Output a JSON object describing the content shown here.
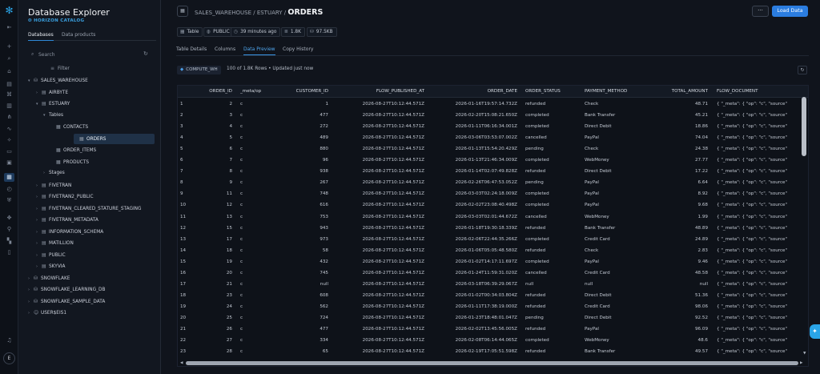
{
  "rail": {
    "icons": [
      "back-icon",
      "add-icon",
      "search-icon",
      "home-icon",
      "worksheet-icon",
      "code-icon",
      "dashboard-icon",
      "graph-icon",
      "activity-icon",
      "ai-icon",
      "marketplace-icon",
      "projects-icon",
      "data-icon",
      "monitor-icon",
      "governance-icon",
      "admin-icon",
      "integrations-icon",
      "compute-icon",
      "docs-icon",
      "notifications-icon"
    ],
    "avatar_initial": "E"
  },
  "explorer": {
    "title": "Database Explorer",
    "subtitle": "HORIZON CATALOG",
    "tabs": [
      {
        "label": "Databases",
        "active": true
      },
      {
        "label": "Data products",
        "active": false
      }
    ],
    "search_placeholder": "Search",
    "filter_label": "Filter",
    "tree": [
      {
        "label": "SALES_WAREHOUSE",
        "depth": 0,
        "caret": "▾",
        "icon": "database-icon"
      },
      {
        "label": "AIRBYTE",
        "depth": 1,
        "caret": "›",
        "icon": "schema-icon"
      },
      {
        "label": "ESTUARY",
        "depth": 1,
        "caret": "▾",
        "icon": "schema-icon"
      },
      {
        "label": "Tables",
        "depth": 2,
        "caret": "▾",
        "icon": ""
      },
      {
        "label": "CONTACTS",
        "depth": 3,
        "caret": "",
        "icon": "table-icon"
      },
      {
        "label": "ORDERS",
        "depth": 3,
        "caret": "",
        "icon": "table-icon",
        "selected": true
      },
      {
        "label": "ORDER_ITEMS",
        "depth": 3,
        "caret": "",
        "icon": "table-icon"
      },
      {
        "label": "PRODUCTS",
        "depth": 3,
        "caret": "",
        "icon": "table-icon"
      },
      {
        "label": "Stages",
        "depth": 2,
        "caret": "›",
        "icon": ""
      },
      {
        "label": "FIVETRAN",
        "depth": 1,
        "caret": "›",
        "icon": "schema-icon"
      },
      {
        "label": "FIVETRAN2_PUBLIC",
        "depth": 1,
        "caret": "›",
        "icon": "schema-icon"
      },
      {
        "label": "FIVETRAN_CLEARED_STATURE_STAGING",
        "depth": 1,
        "caret": "›",
        "icon": "schema-icon"
      },
      {
        "label": "FIVETRAN_METADATA",
        "depth": 1,
        "caret": "›",
        "icon": "schema-icon"
      },
      {
        "label": "INFORMATION_SCHEMA",
        "depth": 1,
        "caret": "›",
        "icon": "schema-icon"
      },
      {
        "label": "MATILLION",
        "depth": 1,
        "caret": "›",
        "icon": "schema-icon"
      },
      {
        "label": "PUBLIC",
        "depth": 1,
        "caret": "›",
        "icon": "schema-icon"
      },
      {
        "label": "SKYVIA",
        "depth": 1,
        "caret": "›",
        "icon": "schema-icon"
      },
      {
        "label": "SNOWFLAKE",
        "depth": 0,
        "caret": "›",
        "icon": "database-icon"
      },
      {
        "label": "SNOWFLAKE_LEARNING_DB",
        "depth": 0,
        "caret": "›",
        "icon": "database-icon"
      },
      {
        "label": "SNOWFLAKE_SAMPLE_DATA",
        "depth": 0,
        "caret": "›",
        "icon": "database-icon"
      },
      {
        "label": "USER$EIS1",
        "depth": 0,
        "caret": "›",
        "icon": "user-icon"
      }
    ]
  },
  "header": {
    "path": "SALES_WAREHOUSE / ESTUARY /",
    "current": "ORDERS",
    "more_label": "···",
    "load_label": "Load Data"
  },
  "chips": [
    {
      "icon": "table-icon",
      "label": "Table"
    },
    {
      "icon": "globe-icon",
      "label": "PUBLIC"
    },
    {
      "icon": "clock-icon",
      "label": "39 minutes ago"
    },
    {
      "icon": "rows-icon",
      "label": "1.8K"
    },
    {
      "icon": "storage-icon",
      "label": "97.5KB"
    }
  ],
  "tabs": [
    {
      "label": "Table Details",
      "active": false
    },
    {
      "label": "Columns",
      "active": false
    },
    {
      "label": "Data Preview",
      "active": true
    },
    {
      "label": "Copy History",
      "active": false
    }
  ],
  "toolbar": {
    "warehouse": "COMPUTE_WH",
    "rows_info": "100 of 1.8K Rows • Updated just now"
  },
  "grid": {
    "columns": [
      "",
      "ORDER_ID",
      "_meta/op",
      "CUSTOMER_ID",
      "FLOW_PUBLISHED_AT",
      "ORDER_DATE",
      "ORDER_STATUS",
      "PAYMENT_METHOD",
      "TOTAL_AMOUNT",
      "FLOW_DOCUMENT"
    ],
    "rows": [
      [
        "1",
        "2",
        "c",
        "1",
        "2026-08-27T10:12:44.571Z",
        "2026-01-16T19:57:14.732Z",
        "refunded",
        "Check",
        "48.71",
        "{ \"_meta\": { \"op\": \"c\", \"source\""
      ],
      [
        "2",
        "3",
        "c",
        "477",
        "2026-08-27T10:12:44.571Z",
        "2026-02-20T15:08:21.650Z",
        "completed",
        "Bank Transfer",
        "45.21",
        "{ \"_meta\": { \"op\": \"c\", \"source\""
      ],
      [
        "3",
        "4",
        "c",
        "272",
        "2026-08-27T10:12:44.571Z",
        "2026-01-11T06:16:34.001Z",
        "completed",
        "Direct Debit",
        "18.86",
        "{ \"_meta\": { \"op\": \"c\", \"source\""
      ],
      [
        "4",
        "5",
        "c",
        "489",
        "2026-08-27T10:12:44.571Z",
        "2026-03-06T03:53:07.002Z",
        "cancelled",
        "PayPal",
        "74.04",
        "{ \"_meta\": { \"op\": \"c\", \"source\""
      ],
      [
        "5",
        "6",
        "c",
        "880",
        "2026-08-27T10:12:44.571Z",
        "2026-01-13T15:54:20.429Z",
        "pending",
        "Check",
        "24.38",
        "{ \"_meta\": { \"op\": \"c\", \"source\""
      ],
      [
        "6",
        "7",
        "c",
        "96",
        "2026-08-27T10:12:44.571Z",
        "2026-01-13T21:46:34.009Z",
        "completed",
        "WebMoney",
        "27.77",
        "{ \"_meta\": { \"op\": \"c\", \"source\""
      ],
      [
        "7",
        "8",
        "c",
        "938",
        "2026-08-27T10:12:44.571Z",
        "2026-01-14T02:07:49.828Z",
        "refunded",
        "Direct Debit",
        "17.22",
        "{ \"_meta\": { \"op\": \"c\", \"source\""
      ],
      [
        "8",
        "9",
        "c",
        "267",
        "2026-08-27T10:12:44.571Z",
        "2026-02-26T06:47:53.052Z",
        "pending",
        "PayPal",
        "6.64",
        "{ \"_meta\": { \"op\": \"c\", \"source\""
      ],
      [
        "9",
        "11",
        "c",
        "748",
        "2026-08-27T10:12:44.571Z",
        "2026-03-03T02:24:18.009Z",
        "completed",
        "PayPal",
        "8.92",
        "{ \"_meta\": { \"op\": \"c\", \"source\""
      ],
      [
        "10",
        "12",
        "c",
        "616",
        "2026-08-27T10:12:44.571Z",
        "2026-02-02T23:08:40.498Z",
        "completed",
        "PayPal",
        "9.68",
        "{ \"_meta\": { \"op\": \"c\", \"source\""
      ],
      [
        "11",
        "13",
        "c",
        "753",
        "2026-08-27T10:12:44.571Z",
        "2026-03-03T02:01:44.672Z",
        "cancelled",
        "WebMoney",
        "1.99",
        "{ \"_meta\": { \"op\": \"c\", \"source\""
      ],
      [
        "12",
        "15",
        "c",
        "943",
        "2026-08-27T10:12:44.571Z",
        "2026-01-18T19:30:18.339Z",
        "refunded",
        "Bank Transfer",
        "48.89",
        "{ \"_meta\": { \"op\": \"c\", \"source\""
      ],
      [
        "13",
        "17",
        "c",
        "973",
        "2026-08-27T10:12:44.571Z",
        "2026-02-06T22:44:35.266Z",
        "completed",
        "Credit Card",
        "24.89",
        "{ \"_meta\": { \"op\": \"c\", \"source\""
      ],
      [
        "14",
        "18",
        "c",
        "58",
        "2026-08-27T10:12:44.571Z",
        "2026-01-06T05:05:48.580Z",
        "refunded",
        "Check",
        "2.83",
        "{ \"_meta\": { \"op\": \"c\", \"source\""
      ],
      [
        "15",
        "19",
        "c",
        "432",
        "2026-08-27T10:12:44.571Z",
        "2026-01-02T14:17:11.697Z",
        "completed",
        "PayPal",
        "9.46",
        "{ \"_meta\": { \"op\": \"c\", \"source\""
      ],
      [
        "16",
        "20",
        "c",
        "745",
        "2026-08-27T10:12:44.571Z",
        "2026-01-24T11:59:31.020Z",
        "cancelled",
        "Credit Card",
        "48.58",
        "{ \"_meta\": { \"op\": \"c\", \"source\""
      ],
      [
        "17",
        "21",
        "c",
        "null",
        "2026-08-27T10:12:44.571Z",
        "2026-03-18T06:39:29.067Z",
        "null",
        "null",
        "null",
        "{ \"_meta\": { \"op\": \"c\", \"source\""
      ],
      [
        "18",
        "23",
        "c",
        "608",
        "2026-08-27T10:12:44.571Z",
        "2026-01-02T00:34:03.804Z",
        "refunded",
        "Direct Debit",
        "51.36",
        "{ \"_meta\": { \"op\": \"c\", \"source\""
      ],
      [
        "19",
        "24",
        "c",
        "562",
        "2026-08-27T10:12:44.571Z",
        "2026-01-11T17:38:19.000Z",
        "refunded",
        "Credit Card",
        "98.06",
        "{ \"_meta\": { \"op\": \"c\", \"source\""
      ],
      [
        "20",
        "25",
        "c",
        "724",
        "2026-08-27T10:12:44.571Z",
        "2026-01-23T18:48:01.047Z",
        "pending",
        "Direct Debit",
        "92.52",
        "{ \"_meta\": { \"op\": \"c\", \"source\""
      ],
      [
        "21",
        "26",
        "c",
        "477",
        "2026-08-27T10:12:44.571Z",
        "2026-02-02T13:45:56.005Z",
        "refunded",
        "PayPal",
        "96.09",
        "{ \"_meta\": { \"op\": \"c\", \"source\""
      ],
      [
        "22",
        "27",
        "c",
        "334",
        "2026-08-27T10:12:44.571Z",
        "2026-02-08T06:14:44.065Z",
        "completed",
        "WebMoney",
        "48.6",
        "{ \"_meta\": { \"op\": \"c\", \"source\""
      ],
      [
        "23",
        "28",
        "c",
        "65",
        "2026-08-27T10:12:44.571Z",
        "2026-02-19T17:05:51.598Z",
        "refunded",
        "Bank Transfer",
        "49.57",
        "{ \"_meta\": { \"op\": \"c\", \"source\""
      ]
    ]
  },
  "colors": {
    "accent": "#2b7de0",
    "brand": "#2aa5e8",
    "background": "#10141c",
    "sidebar": "#121720",
    "selected_row": "#1f3147"
  }
}
